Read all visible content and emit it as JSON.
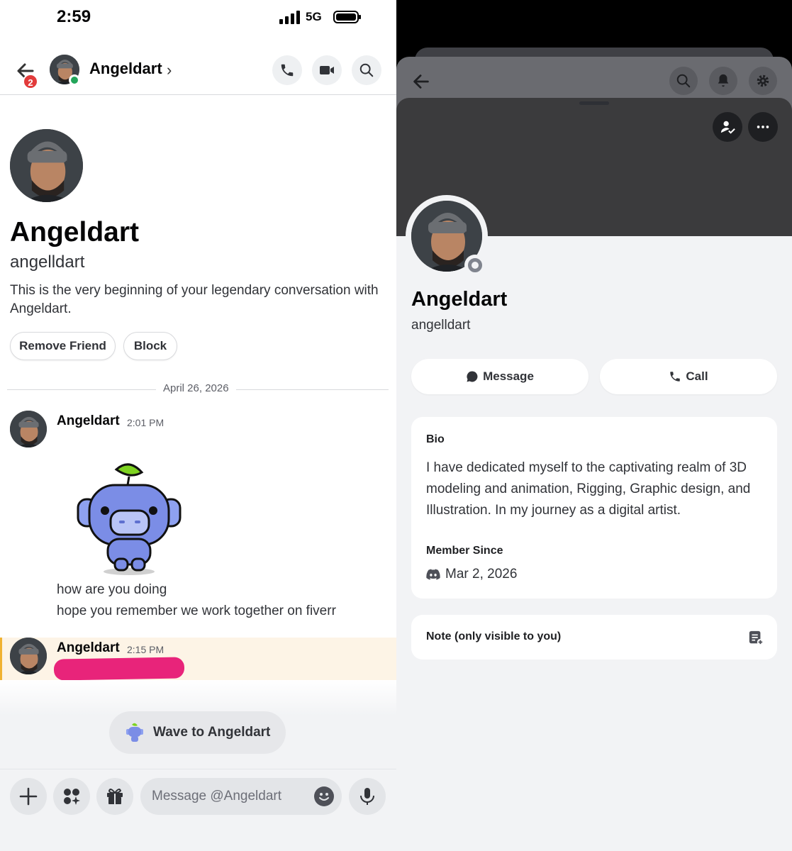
{
  "status_bar": {
    "time": "2:59",
    "network": "5G"
  },
  "chat_header": {
    "name": "Angeldart",
    "unread_badge": "2"
  },
  "profile_intro": {
    "display_name": "Angeldart",
    "username": "angelldart",
    "intro_text": "This is the very beginning of your legendary conversation with Angeldart.",
    "remove_friend_label": "Remove Friend",
    "block_label": "Block"
  },
  "date_divider": "April 26, 2026",
  "messages": [
    {
      "author": "Angeldart",
      "time": "2:01 PM",
      "lines": [
        "how are you doing",
        "hope you remember we work together on fiverr"
      ]
    },
    {
      "author": "Angeldart",
      "time": "2:15 PM"
    }
  ],
  "wave_label": "Wave to Angeldart",
  "composer": {
    "placeholder": "Message @Angeldart"
  },
  "profile_panel": {
    "display_name": "Angeldart",
    "username": "angelldart",
    "message_label": "Message",
    "call_label": "Call",
    "bio_heading": "Bio",
    "bio_text": "I have dedicated myself to the captivating realm of 3D modeling and animation, Rigging, Graphic design, and Illustration. In my journey as a digital artist.",
    "member_since_heading": "Member Since",
    "member_since": "Mar 2, 2026",
    "note_label": "Note (only visible to you)"
  },
  "colors": {
    "online": "#23a55a",
    "badge": "#e23b3b",
    "highlight": "#fdf4e6",
    "mascot": "#7b8de6"
  }
}
